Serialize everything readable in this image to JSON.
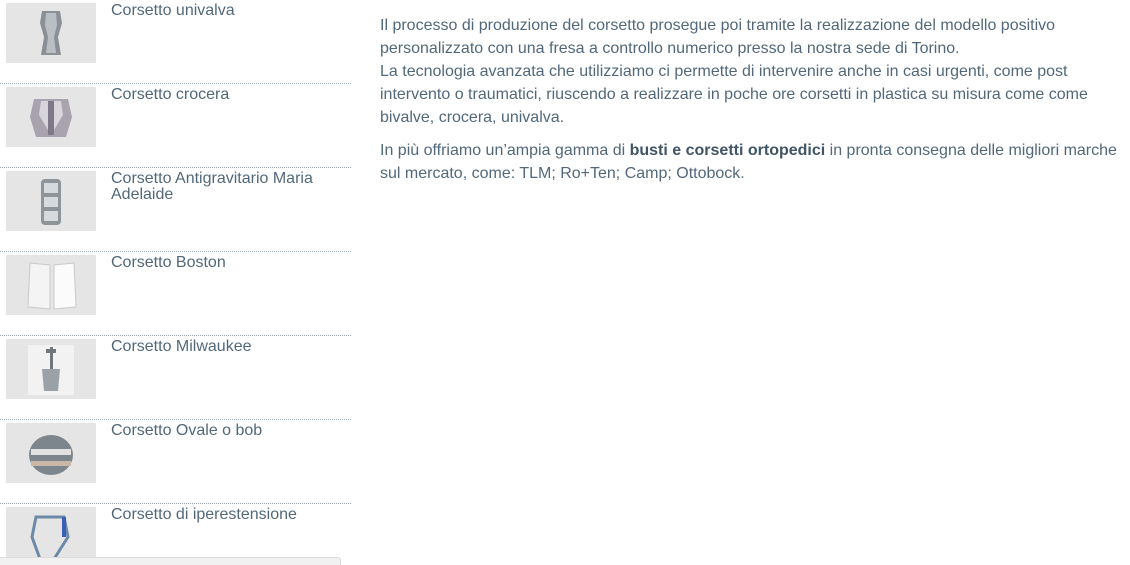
{
  "sidebar": {
    "items": [
      {
        "label": "Corsetto univalva",
        "icon": "corset-univalve-icon"
      },
      {
        "label": "Corsetto crocera",
        "icon": "corset-crocera-icon"
      },
      {
        "label": "Corsetto Antigravitario Maria Adelaide",
        "icon": "corset-antigravity-icon"
      },
      {
        "label": "Corsetto Boston",
        "icon": "corset-boston-icon"
      },
      {
        "label": "Corsetto Milwaukee",
        "icon": "corset-milwaukee-icon"
      },
      {
        "label": "Corsetto Ovale o bob",
        "icon": "corset-oval-icon"
      },
      {
        "label": "Corsetto di iperestensione",
        "icon": "corset-hyperextension-icon"
      }
    ]
  },
  "content": {
    "p1_line1": "Il processo di produzione del corsetto prosegue poi tramite la realizzazione del modello positivo personalizzato con una fresa a controllo numerico presso la nostra sede di Torino.",
    "p1_line2": "La tecnologia avanzata che utilizziamo ci permette di intervenire anche in casi urgenti, come post intervento o traumatici, riuscendo a realizzare in poche ore corsetti in plastica su misura come come bivalve, crocera, univalva.",
    "p2_before": "In più offriamo un’ampia gamma di ",
    "p2_bold": "busti e corsetti ortopedici",
    "p2_after": " in pronta consegna delle migliori marche sul mercato, come: TLM; Ro+Ten; Camp; Ottobock."
  }
}
